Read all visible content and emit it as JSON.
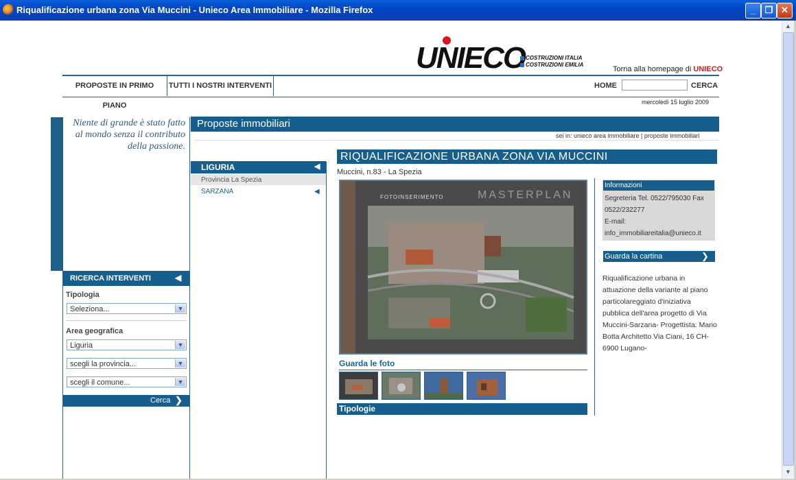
{
  "window": {
    "title": "Riqualificazione urbana zona Via Muccini - Unieco Area Immobiliare - Mozilla Firefox",
    "controls": [
      "_",
      "❐",
      "✕"
    ]
  },
  "header": {
    "logo_text": "UNIECO",
    "logo_sub1": "COSTRUZIONI ITALIA",
    "logo_sub2": "COSTRUZIONI EMILIA",
    "home_link_prefix": "Torna alla homepage di",
    "home_link_brand": "UNIECO",
    "nav": [
      "PROPOSTE IN PRIMO PIANO",
      "TUTTI I NOSTRI INTERVENTI"
    ],
    "home": "HOME",
    "search_button": "CERCA",
    "date": "mercoledì 15 luglio 2009"
  },
  "left": {
    "quote": "Niente di grande è stato fatto al mondo senza il contributo della passione.",
    "search_title": "RICERCA INTERVENTI",
    "tipologia_label": "Tipologia",
    "tipologia_value": "Seleziona...",
    "area_label": "Area geografica",
    "area_value": "Liguria",
    "provincia_value": "scegli la provincia...",
    "comune_value": "scegli il comune...",
    "search_button": "Cerca"
  },
  "main": {
    "section_title": "Proposte immobiliari",
    "breadcrumb": "sei in: unieco area immobiliare | proposte immobiliari",
    "region": "LIGURIA",
    "province": "Provincia La Spezia",
    "town": "SARZANA",
    "title": "RIQUALIFICAZIONE URBANA ZONA VIA MUCCINI",
    "address": "Muccini, n.83 - La Spezia",
    "photo_caption_left": "FOTOINSERIMENTO",
    "photo_caption_right": "MASTERPLAN",
    "photos_label": "Guarda le foto",
    "tipologie_label": "Tipologie"
  },
  "info": {
    "title": "Informazioni",
    "line1": "Segreteria Tel. 0522/795030 Fax",
    "line2": "0522/232277",
    "line3": "E-mail:",
    "line4": "info_immobiliareitalia@unieco.it",
    "map_button": "Guarda la cartina",
    "description": "Riqualificazione urbana in attuazione della variante al piano particolareggiato d'iniziativa pubblica dell'area progetto di Via Muccini-Sarzana- Progettista: Mario Botta Architetto Via Ciani, 16 CH-6900 Lugano-"
  },
  "colors": {
    "brand_blue": "#165e8e",
    "logo_red": "#e0151b"
  }
}
